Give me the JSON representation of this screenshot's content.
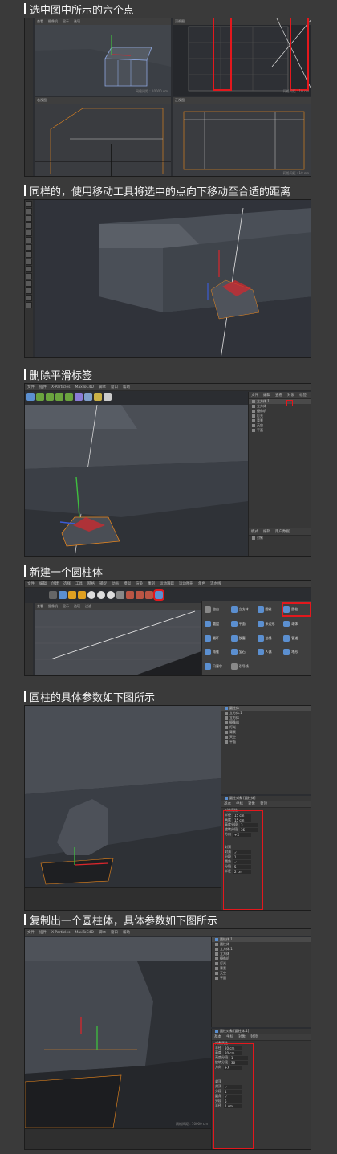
{
  "steps": [
    {
      "heading": "选中图中所示的六个点"
    },
    {
      "heading": "同样的，使用移动工具将选中的点向下移动至合适的距离"
    },
    {
      "heading": "删除平滑标签"
    },
    {
      "heading": "新建一个圆柱体"
    },
    {
      "heading": "圆柱的具体参数如下图所示"
    },
    {
      "heading": "复制出一个圆柱体，具体参数如下图所示"
    }
  ],
  "viewport_menu": [
    "查看",
    "摄像机",
    "显示",
    "选项",
    "过滤",
    "面板"
  ],
  "main_menu": [
    "文件",
    "编辑",
    "创建",
    "选择",
    "工具",
    "网格",
    "捕捉",
    "动画",
    "模拟",
    "渲染",
    "雕刻",
    "运动跟踪",
    "运动图形",
    "角色",
    "流水线",
    "插件",
    "X-Particles",
    "MaxToC4D",
    "脚本",
    "窗口",
    "帮助"
  ],
  "s1": {
    "vp_labels": [
      "透视视图",
      "顶视图",
      "右视图",
      "正视图"
    ],
    "grid": [
      "网格间距 : 10000 cm",
      "网格间距 : 10 cm",
      "网格间距 : 10 cm",
      "网格间距 : 10 cm"
    ]
  },
  "s2": {
    "vp_label": "透视视图"
  },
  "s3": {
    "menu": [
      "文件",
      "编辑",
      "查看",
      "对象",
      "标签",
      "书签"
    ],
    "objects": [
      "立方体.1",
      "立方体",
      "摄像机",
      "灯光",
      "背景",
      "天空",
      "平面"
    ],
    "attr_tabs": [
      "模式",
      "编辑",
      "用户数据"
    ],
    "attr_item": "对象"
  },
  "s4": {
    "create_items": [
      "空白",
      "立方体",
      "圆锥",
      "圆柱",
      "圆盘",
      "平面",
      "多边形",
      "球体",
      "圆环",
      "胶囊",
      "油桶",
      "管道",
      "角锥",
      "宝石",
      "人偶",
      "地形",
      "贝塞尔",
      "引导线"
    ]
  },
  "s5": {
    "objects": [
      "圆柱体",
      "立方体.1",
      "立方体",
      "摄像机",
      "灯光",
      "背景",
      "天空",
      "平面"
    ],
    "attr_title": "圆柱对象 [圆柱体]",
    "attr_tabs": [
      "基本",
      "坐标",
      "对象",
      "封顶"
    ],
    "section_object": "对象属性",
    "fields": [
      {
        "label": "半径",
        "value": "15 cm"
      },
      {
        "label": "高度",
        "value": "15 cm"
      },
      {
        "label": "高度分段",
        "value": "3"
      },
      {
        "label": "旋转分段",
        "value": "36"
      },
      {
        "label": "方向",
        "value": "+X"
      }
    ],
    "section_cap": "封顶",
    "cap_fields": [
      {
        "label": "封顶",
        "value": "✓"
      },
      {
        "label": "分段",
        "value": "1"
      },
      {
        "label": "圆角",
        "value": "✓"
      },
      {
        "label": "分段",
        "value": "5"
      },
      {
        "label": "半径",
        "value": "2 cm"
      }
    ]
  },
  "s6": {
    "objects": [
      "圆柱体.1",
      "圆柱体",
      "立方体.1",
      "立方体",
      "摄像机",
      "灯光",
      "背景",
      "天空",
      "平面"
    ],
    "attr_title": "圆柱对象 [圆柱体.1]",
    "attr_tabs": [
      "基本",
      "坐标",
      "对象",
      "封顶"
    ],
    "section_object": "对象属性",
    "fields": [
      {
        "label": "半径",
        "value": "20 cm"
      },
      {
        "label": "高度",
        "value": "20 cm"
      },
      {
        "label": "高度分段",
        "value": "1"
      },
      {
        "label": "旋转分段",
        "value": "36"
      },
      {
        "label": "方向",
        "value": "+X"
      }
    ],
    "section_cap": "封顶",
    "cap_fields": [
      {
        "label": "封顶",
        "value": "✓"
      },
      {
        "label": "分段",
        "value": "1"
      },
      {
        "label": "圆角",
        "value": "✓"
      },
      {
        "label": "分段",
        "value": "5"
      },
      {
        "label": "半径",
        "value": "1 cm"
      }
    ],
    "grid": "网格间距 : 10000 cm"
  },
  "colors": {
    "accent_red": "#e3181d",
    "selection_orange": "#f08a1c",
    "axis_red": "#d9262c",
    "axis_green": "#3fbf3f",
    "axis_blue": "#3b5bd6"
  }
}
